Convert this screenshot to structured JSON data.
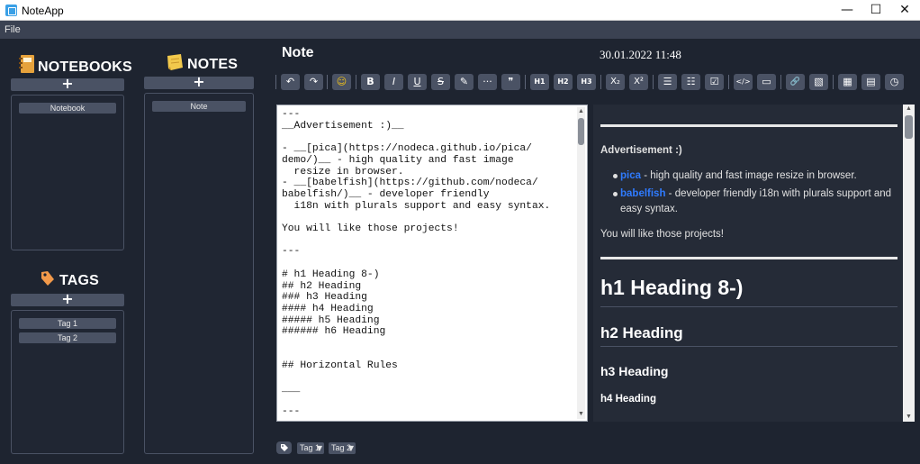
{
  "window": {
    "title": "NoteApp",
    "minimize": "—",
    "maximize": "☐",
    "close": "✕"
  },
  "menu": {
    "file": "File"
  },
  "notebooks": {
    "heading": "NOTEBOOKS",
    "add": "+",
    "items": [
      "Notebook"
    ]
  },
  "notes": {
    "heading": "NOTES",
    "add": "+",
    "items": [
      "Note"
    ]
  },
  "tags": {
    "heading": "TAGS",
    "add": "+",
    "items": [
      "Tag 1",
      "Tag 2"
    ]
  },
  "note": {
    "title": "Note",
    "date": "30.01.2022 11:48"
  },
  "toolbar": {
    "undo": "↶",
    "redo": "↷",
    "emoji": "☺",
    "bold": "B",
    "italic": "I",
    "underline": "U",
    "strike": "S",
    "highlight": "✎",
    "hr": "···",
    "quote": "❞",
    "h1": "H1",
    "h2": "H2",
    "h3": "H3",
    "sub": "X₂",
    "sup": "X²",
    "ul": "☰",
    "ol": "☷",
    "checklist": "☑",
    "code": "</>",
    "codeblock": "▭",
    "link": "🔗",
    "image": "▧",
    "table": "▦",
    "calendar": "▤",
    "clock": "◷"
  },
  "editor": {
    "text": "---\n__Advertisement :)__\n\n- __[pica](https://nodeca.github.io/pica/\ndemo/)__ - high quality and fast image\n  resize in browser.\n- __[babelfish](https://github.com/nodeca/\nbabelfish/)__ - developer friendly\n  i18n with plurals support and easy syntax.\n\nYou will like those projects!\n\n---\n\n# h1 Heading 8-)\n## h2 Heading\n### h3 Heading\n#### h4 Heading\n##### h5 Heading\n###### h6 Heading\n\n\n## Horizontal Rules\n\n___\n\n---"
  },
  "preview": {
    "ad_heading": "Advertisement :)",
    "item1_link": "pica",
    "item1_text": " - high quality and fast image resize in browser.",
    "item2_link": "babelfish",
    "item2_text": " - developer friendly i18n with plurals support and",
    "item2_text2": "easy syntax.",
    "like": "You will like those projects!",
    "h1": "h1 Heading 8-)",
    "h2": "h2 Heading",
    "h3": "h3 Heading",
    "h4": "h4 Heading"
  },
  "bottom_tags": {
    "tag_icon": "🏷",
    "selected": [
      "Tag 1",
      "Tag 2"
    ],
    "caret": "▼"
  }
}
